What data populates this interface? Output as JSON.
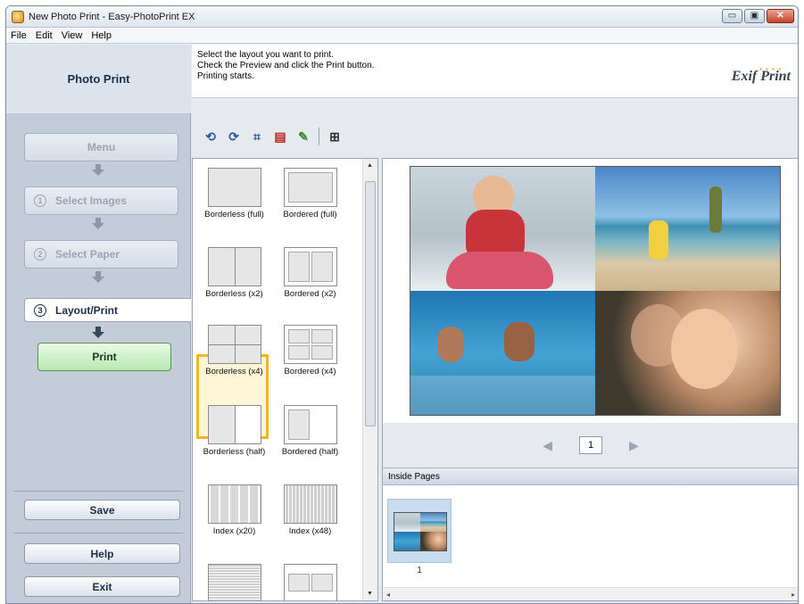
{
  "window": {
    "title": "New Photo Print - Easy-PhotoPrint EX",
    "min_symbol": "▭",
    "max_symbol": "▣",
    "close_symbol": "✕"
  },
  "menu": [
    "File",
    "Edit",
    "View",
    "Help"
  ],
  "sidebar": {
    "header": "Photo Print",
    "menu_label": "Menu",
    "steps": [
      {
        "num": "1",
        "label": "Select Images"
      },
      {
        "num": "2",
        "label": "Select Paper"
      },
      {
        "num": "3",
        "label": "Layout/Print"
      }
    ],
    "print_label": "Print",
    "save_label": "Save",
    "help_label": "Help",
    "exit_label": "Exit"
  },
  "instructions": [
    "Select the layout you want to print.",
    "Check the Preview and click the Print button.",
    "Printing starts."
  ],
  "brand": "Exif Print",
  "toolbar": {
    "icons": [
      "rotate-left-icon",
      "rotate-right-icon",
      "crop-icon",
      "frame-icon",
      "correct-image-icon",
      "date-settings-icon"
    ]
  },
  "layouts": [
    {
      "label": "Borderless (full)"
    },
    {
      "label": "Bordered (full)"
    },
    {
      "label": "Borderless (x2)"
    },
    {
      "label": "Bordered (x2)"
    },
    {
      "label": "Borderless (x4)",
      "selected": true
    },
    {
      "label": "Bordered (x4)"
    },
    {
      "label": "Borderless (half)"
    },
    {
      "label": "Bordered (half)"
    },
    {
      "label": "Index (x20)"
    },
    {
      "label": "Index (x48)"
    }
  ],
  "pager": {
    "page": "1",
    "prev": "◀",
    "next": "▶"
  },
  "inside_pages": {
    "header": "Inside Pages",
    "page_label": "1"
  },
  "scroll": {
    "up": "▲",
    "down": "▼",
    "left": "◂",
    "right": "▸"
  },
  "colors": {
    "selected_border": "#f4b521",
    "print_button": "#b7e8b0",
    "accent": "#1d2e48"
  }
}
